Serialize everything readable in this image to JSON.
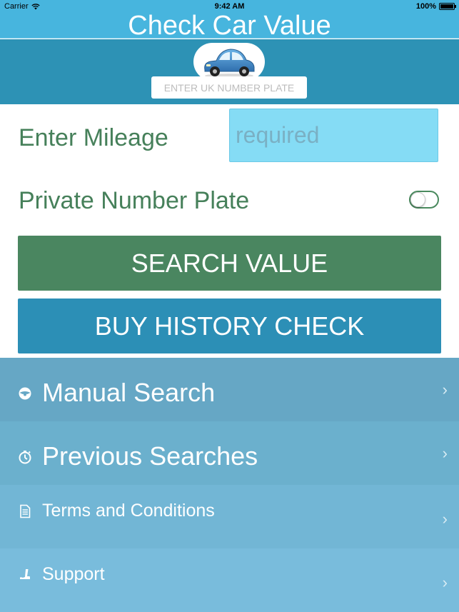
{
  "status_bar": {
    "carrier": "Carrier",
    "time": "9:42 AM",
    "battery": "100%"
  },
  "nav": {
    "title": "Check Car Value"
  },
  "plate": {
    "car_icon": "car-icon",
    "placeholder": "ENTER UK NUMBER PLATE"
  },
  "form": {
    "mileage_label": "Enter Mileage",
    "mileage_placeholder": "required",
    "private_plate_label": "Private Number Plate",
    "private_plate_on": false
  },
  "buttons": {
    "search": "SEARCH VALUE",
    "history": "BUY HISTORY CHECK"
  },
  "menu": {
    "items": [
      {
        "label": "Manual Search",
        "icon": "steering-wheel-icon"
      },
      {
        "label": "Previous Searches",
        "icon": "stopwatch-icon"
      },
      {
        "label": "Terms and Conditions",
        "icon": "document-icon"
      },
      {
        "label": "Support",
        "icon": "support-icon"
      }
    ],
    "chevron": "›"
  },
  "colors": {
    "header": "#47b5de",
    "plate_area": "#2d92b5",
    "green": "#4a8660",
    "blue": "#2c8fb6"
  }
}
